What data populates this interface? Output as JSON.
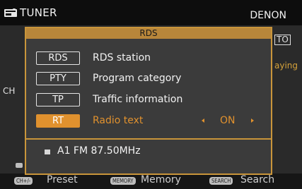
{
  "header": {
    "source": "TUNER",
    "brand": "DENON",
    "source_icon": "tuner-icon"
  },
  "background": {
    "auto_text": "TO",
    "playing_text": "aying",
    "ch_text": "CH",
    "footer": {
      "ch_key": "CH+/-",
      "ch_label": "Preset",
      "memory_key": "MEMORY",
      "memory_label": "Memory",
      "search_key": "SEARCH",
      "search_label": "Search"
    }
  },
  "dialog": {
    "title": "RDS",
    "items": [
      {
        "key": "RDS",
        "label": "RDS station"
      },
      {
        "key": "PTY",
        "label": "Program category"
      },
      {
        "key": "TP",
        "label": "Traffic information"
      },
      {
        "key": "RT",
        "label": "Radio text",
        "value": "ON",
        "selected": true
      }
    ],
    "status": {
      "station": "A1 FM 87.50MHz"
    }
  },
  "colors": {
    "accent": "#e0912e",
    "frame": "#c9953a",
    "title_bar": "#b8863a"
  }
}
